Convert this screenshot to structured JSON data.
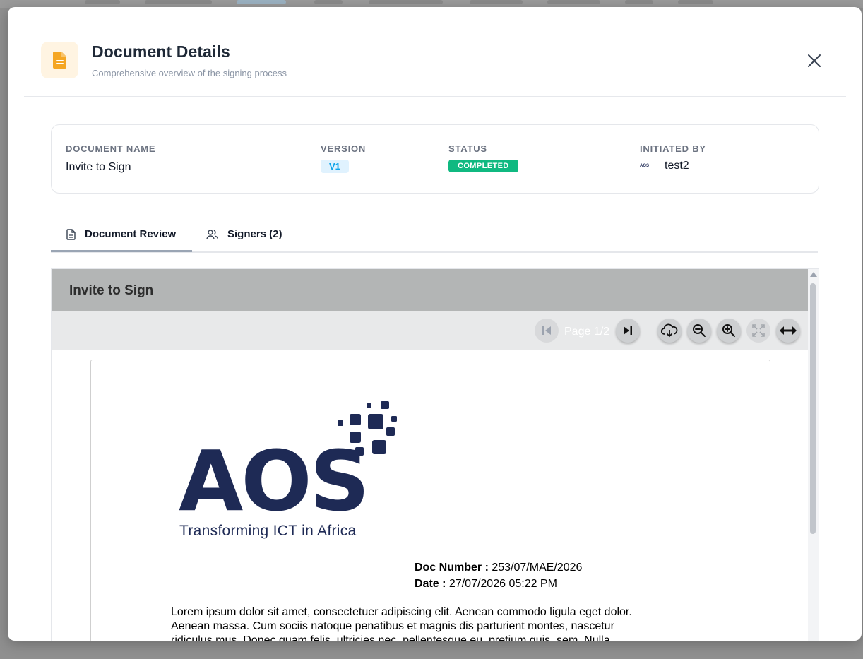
{
  "modal": {
    "title": "Document Details",
    "subtitle": "Comprehensive overview of the signing process"
  },
  "info": {
    "doc_name_label": "DOCUMENT NAME",
    "doc_name": "Invite to Sign",
    "version_label": "VERSION",
    "version": "V1",
    "status_label": "STATUS",
    "status": "COMPLETED",
    "initiated_label": "INITIATED BY",
    "initiator_avatar": "AOS",
    "initiator": "test2"
  },
  "tabs": [
    {
      "label": "Document Review",
      "icon": "document-icon",
      "active": true
    },
    {
      "label": "Signers (2)",
      "icon": "users-icon",
      "active": false
    }
  ],
  "viewer": {
    "title": "Invite to Sign",
    "page_indicator": "Page 1/2",
    "toolbar": [
      "first-page-icon",
      "last-page-icon",
      "download-icon",
      "zoom-out-icon",
      "zoom-in-icon",
      "fullscreen-icon",
      "fit-width-icon"
    ]
  },
  "document": {
    "logo_text": "AOS",
    "logo_tagline": "Transforming ICT in Africa",
    "doc_number_label": "Doc  Number",
    "doc_number": "253/07/MAE/2026",
    "date_label": "Date",
    "date": "27/07/2026 05:22 PM",
    "body_line1": "Lorem ipsum dolor sit amet, consectetuer adipiscing elit. Aenean commodo ligula eget dolor.",
    "body_line2": "Aenean massa. Cum sociis natoque penatibus et magnis dis parturient montes, nascetur",
    "body_line3": "ridiculus mus. Donec quam felis, ultricies nec, pellentesque eu, pretium quis, sem. Nulla"
  },
  "colors": {
    "accent_orange": "#f5a623",
    "status_green": "#10b981",
    "version_blue": "#0ea5e9",
    "logo_navy": "#1e2a55"
  }
}
